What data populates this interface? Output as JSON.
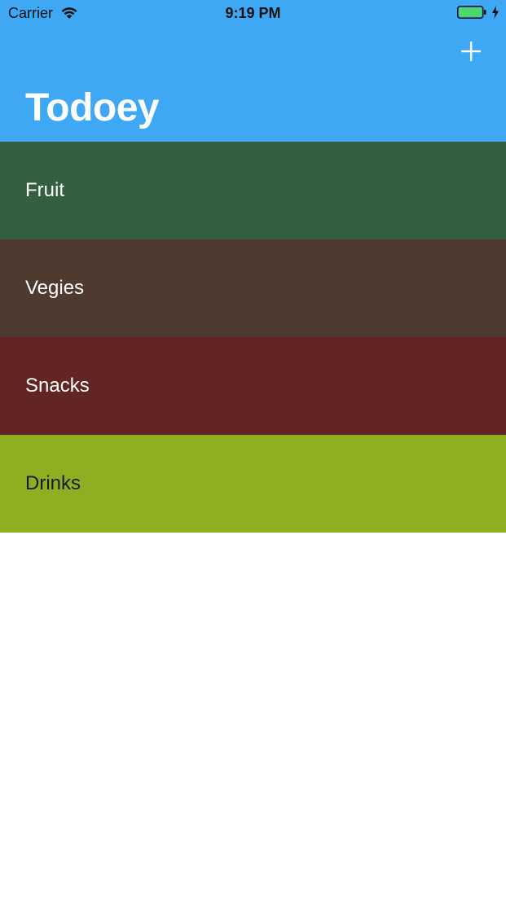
{
  "status_bar": {
    "carrier": "Carrier",
    "time": "9:19 PM",
    "battery_color": "#4cd964"
  },
  "nav": {
    "title": "Todoey",
    "add_icon": "plus-icon",
    "background_color": "#3ea8f5"
  },
  "categories": [
    {
      "name": "Fruit",
      "color": "#336041",
      "text_color": "#ffffff"
    },
    {
      "name": "Vegies",
      "color": "#4f3a2f",
      "text_color": "#ffffff"
    },
    {
      "name": "Snacks",
      "color": "#632523",
      "text_color": "#ffffff"
    },
    {
      "name": "Drinks",
      "color": "#8faf23",
      "text_color": "#1a1a1a"
    }
  ]
}
